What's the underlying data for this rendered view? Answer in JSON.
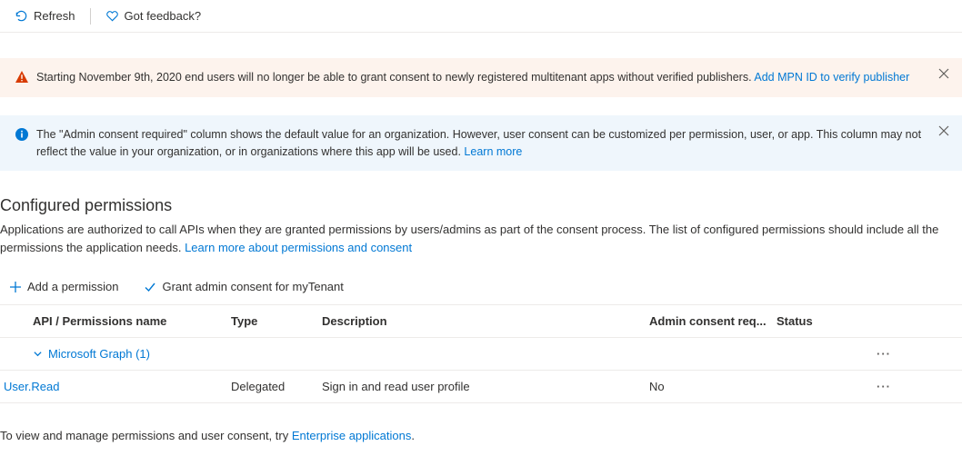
{
  "toolbar": {
    "refresh": "Refresh",
    "feedback": "Got feedback?"
  },
  "banners": {
    "warning": {
      "text": "Starting November 9th, 2020 end users will no longer be able to grant consent to newly registered multitenant apps without verified publishers.",
      "link": "Add MPN ID to verify publisher"
    },
    "info": {
      "text": "The \"Admin consent required\" column shows the default value for an organization. However, user consent can be customized per permission, user, or app. This column may not reflect the value in your organization, or in organizations where this app will be used.",
      "link": "Learn more"
    }
  },
  "section": {
    "title": "Configured permissions",
    "desc": "Applications are authorized to call APIs when they are granted permissions by users/admins as part of the consent process. The list of configured permissions should include all the permissions the application needs.",
    "desc_link": "Learn more about permissions and consent"
  },
  "actions": {
    "add": "Add a permission",
    "grant": "Grant admin consent for myTenant"
  },
  "table": {
    "headers": {
      "name": "API / Permissions name",
      "type": "Type",
      "description": "Description",
      "admin": "Admin consent req...",
      "status": "Status"
    },
    "group": "Microsoft Graph (1)",
    "rows": [
      {
        "name": "User.Read",
        "type": "Delegated",
        "description": "Sign in and read user profile",
        "admin": "No",
        "status": ""
      }
    ]
  },
  "footer": {
    "text": "To view and manage permissions and user consent, try ",
    "link": "Enterprise applications"
  }
}
